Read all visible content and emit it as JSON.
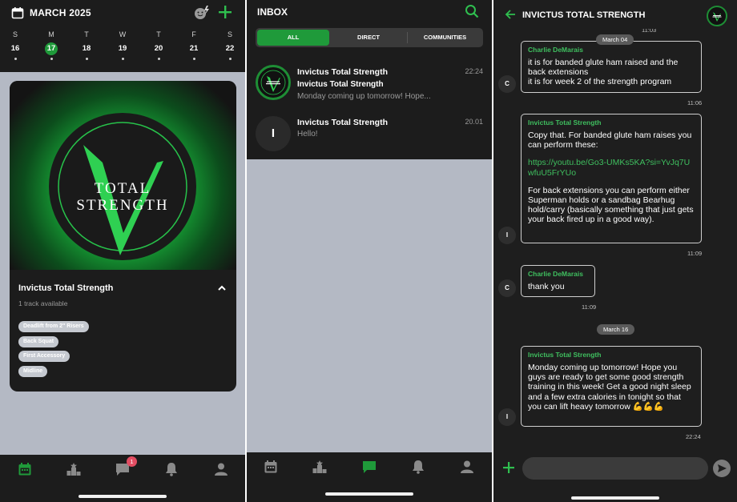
{
  "colors": {
    "accent": "#1f9a3a",
    "accent_text": "#3fbf5f",
    "background": "#1c1c1c",
    "placeholder_area": "#b4b9c4",
    "badge": "#e24d62"
  },
  "calendar_screen": {
    "month_title": "MARCH 2025",
    "icons": {
      "calendar": "calendar-icon",
      "status": "smiley-bolt-icon",
      "add": "plus-icon"
    },
    "week": [
      {
        "label": "S",
        "date": "16"
      },
      {
        "label": "M",
        "date": "17",
        "selected": true
      },
      {
        "label": "T",
        "date": "18"
      },
      {
        "label": "W",
        "date": "19"
      },
      {
        "label": "T",
        "date": "20"
      },
      {
        "label": "F",
        "date": "21"
      },
      {
        "label": "S",
        "date": "22"
      }
    ],
    "program_card": {
      "logo_line1": "TOTAL",
      "logo_line2": "STRENGTH",
      "title": "Invictus Total Strength",
      "subtitle": "1 track available",
      "tags": [
        "Deadlift from 2\" Risers",
        "Back Squat",
        "First Accessory",
        "Midline"
      ]
    },
    "tabbar": {
      "active": "calendar",
      "chat_badge": "1"
    }
  },
  "inbox_screen": {
    "title": "INBOX",
    "segments": [
      "ALL",
      "DIRECT",
      "COMMUNITIES"
    ],
    "active_segment": "ALL",
    "messages": [
      {
        "name": "Invictus Total Strength",
        "subname": "Invictus Total Strength",
        "preview": "Monday coming up tomorrow! Hope...",
        "time": "22:24",
        "avatar": "logo"
      },
      {
        "name": "Invictus Total Strength",
        "subname": "",
        "preview": "Hello!",
        "time": "20.01",
        "avatar": "I"
      }
    ],
    "tabbar": {
      "active": "chat"
    }
  },
  "chat_screen": {
    "title": "INVICTUS TOTAL STRENGTH",
    "top_time": "11:03",
    "date_pills": [
      "March 04",
      "March 16"
    ],
    "messages": [
      {
        "from": "Charlie DeMarais",
        "avatar": "C",
        "lines": [
          "it is for banded glute ham raised and the back extensions",
          "it is for week 2 of the strength program"
        ],
        "time": "11:06"
      },
      {
        "from": "Invictus Total Strength",
        "avatar": "I",
        "text1": "Copy that. For banded glute ham raises you can perform these:",
        "link": "https://youtu.be/Go3-UMKs5KA?si=YvJq7UwfuU5FrYUo",
        "text2": "For back extensions you can perform either Superman holds or a sandbag Bearhug hold/carry (basically something that just gets your back fired up in a good way).",
        "time": "11:09"
      },
      {
        "from": "Charlie DeMarais",
        "avatar": "C",
        "text": "thank you",
        "time": "11:09"
      },
      {
        "from": "Invictus Total Strength",
        "avatar": "I",
        "text": "Monday coming up tomorrow! Hope you guys are ready to get some good strength training in this week! Get a good night sleep and a few extra calories in tonight so that you can lift heavy tomorrow 💪💪💪",
        "time": "22:24"
      }
    ],
    "input_placeholder": ""
  }
}
